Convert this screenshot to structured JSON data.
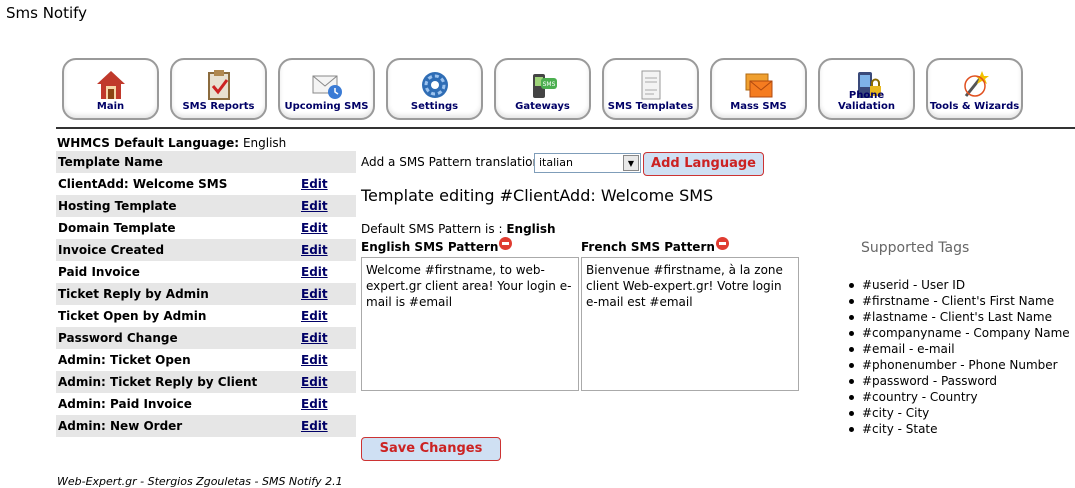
{
  "app_title": "Sms Notify",
  "toolbar": [
    {
      "label": "Main",
      "icon": "house-icon"
    },
    {
      "label": "SMS Reports",
      "icon": "clipboard-check-icon"
    },
    {
      "label": "Upcoming SMS",
      "icon": "envelope-clock-icon"
    },
    {
      "label": "Settings",
      "icon": "gear-icon"
    },
    {
      "label": "Gateways",
      "icon": "phone-sms-icon"
    },
    {
      "label": "SMS Templates",
      "icon": "template-document-icon"
    },
    {
      "label": "Mass SMS",
      "icon": "envelopes-icon"
    },
    {
      "label": "Phone Validation",
      "icon": "phone-lock-icon"
    },
    {
      "label": "Tools & Wizards",
      "icon": "wand-tools-icon"
    }
  ],
  "whmcs_language": {
    "label": "WHMCS Default Language:",
    "value": "English"
  },
  "template_table": {
    "header": "Template Name",
    "edit_label": "Edit",
    "rows": [
      "ClientAdd: Welcome SMS",
      "Hosting Template",
      "Domain Template",
      "Invoice Created",
      "Paid Invoice",
      "Ticket Reply by Admin",
      "Ticket Open by Admin",
      "Password Change",
      "Admin: Ticket Open",
      "Admin: Ticket Reply by Client",
      "Admin: Paid Invoice",
      "Admin: New Order"
    ]
  },
  "add_translation": {
    "label": "Add a SMS Pattern translation:",
    "selected": "italian",
    "button": "Add Language"
  },
  "editing_title": "Template editing #ClientAdd: Welcome SMS",
  "default_pattern": {
    "label": "Default SMS Pattern is :",
    "value": "English"
  },
  "patterns": {
    "english": {
      "label": "English SMS Pattern",
      "text": "Welcome #firstname, to web-expert.gr client area!  Your login e-mail is #email"
    },
    "french": {
      "label": "French SMS Pattern",
      "text": "Bienvenue #firstname, à la zone client Web-expert.gr! Votre login e-mail est #email"
    }
  },
  "supported_tags": {
    "title": "Supported Tags",
    "items": [
      "#userid - User ID",
      "#firstname - Client's First Name",
      "#lastname - Client's Last Name",
      "#companyname - Company Name",
      "#email - e-mail",
      "#phonenumber - Phone Number",
      "#password - Password",
      "#country - Country",
      "#city - City",
      "#city - State"
    ]
  },
  "save_button": "Save Changes",
  "footer": "Web-Expert.gr - Stergios Zgouletas - SMS Notify 2.1"
}
